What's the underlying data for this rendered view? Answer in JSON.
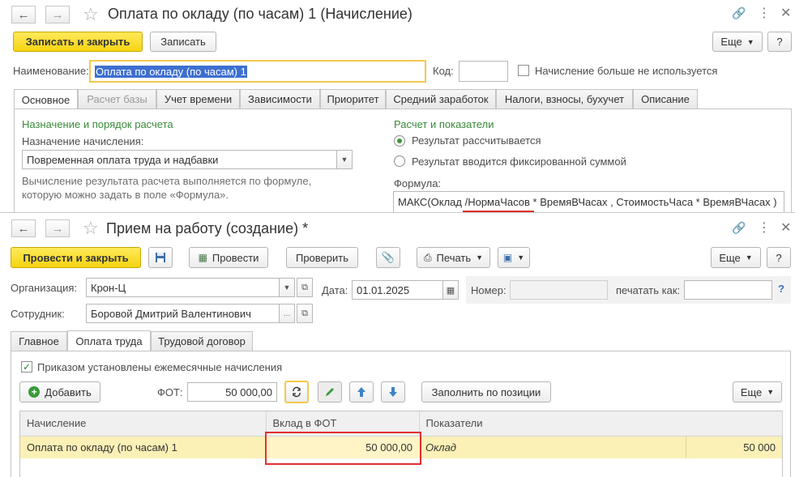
{
  "win1": {
    "title": "Оплата по окладу (по часам) 1 (Начисление)",
    "save_close": "Записать и закрыть",
    "save": "Записать",
    "more": "Еще",
    "help": "?",
    "name_label": "Наименование:",
    "name_value": "Оплата по окладу (по часам) 1",
    "code_label": "Код:",
    "code_value": "",
    "not_used_label": "Начисление больше не используется",
    "tabs": [
      "Основное",
      "Расчет базы",
      "Учет времени",
      "Зависимости",
      "Приоритет",
      "Средний заработок",
      "Налоги, взносы, бухучет",
      "Описание"
    ],
    "purpose_header": "Назначение и порядок расчета",
    "purpose_label": "Назначение начисления:",
    "purpose_value": "Повременная оплата труда и надбавки",
    "hint_line1": "Вычисление результата расчета выполняется по формуле,",
    "hint_line2": "которую можно задать в поле «Формула».",
    "calc_header": "Расчет и показатели",
    "radio_calc": "Результат рассчитывается",
    "radio_fixed": "Результат вводится фиксированной суммой",
    "formula_label": "Формула:",
    "formula_value": "МАКС(Оклад /НормаЧасов * ВремяВЧасах  , СтоимостьЧаса * ВремяВЧасах )"
  },
  "win2": {
    "title": "Прием на работу (создание) *",
    "post_close": "Провести и закрыть",
    "post": "Провести",
    "check": "Проверить",
    "print": "Печать",
    "more": "Еще",
    "help": "?",
    "org_label": "Организация:",
    "org_value": "Крон-Ц",
    "date_label": "Дата:",
    "date_value": "01.01.2025",
    "number_label": "Номер:",
    "number_value": "",
    "print_as_label": "печатать как:",
    "print_as_value": "",
    "help_link": "?",
    "employee_label": "Сотрудник:",
    "employee_value": "Боровой Дмитрий Валентинович",
    "tabs": [
      "Главное",
      "Оплата труда",
      "Трудовой договор"
    ],
    "monthly_label": "Приказом установлены ежемесячные начисления",
    "add": "Добавить",
    "fot_label": "ФОТ:",
    "fot_value": "50 000,00",
    "fill_by_position": "Заполнить по позиции",
    "grid_more": "Еще",
    "grid": {
      "headers": [
        "Начисление",
        "Вклад в ФОТ",
        "Показатели"
      ],
      "rows": [
        {
          "accrual": "Оплата по окладу (по часам) 1",
          "contribution": "50 000,00",
          "indicator": "Оклад",
          "indicator_value": "50 000"
        }
      ]
    }
  },
  "colors": {
    "accent_yellow": "#f5d412",
    "selection_row": "#fbf0b6",
    "highlight_red": "#e0302e",
    "section_green": "#3a8a3a"
  }
}
